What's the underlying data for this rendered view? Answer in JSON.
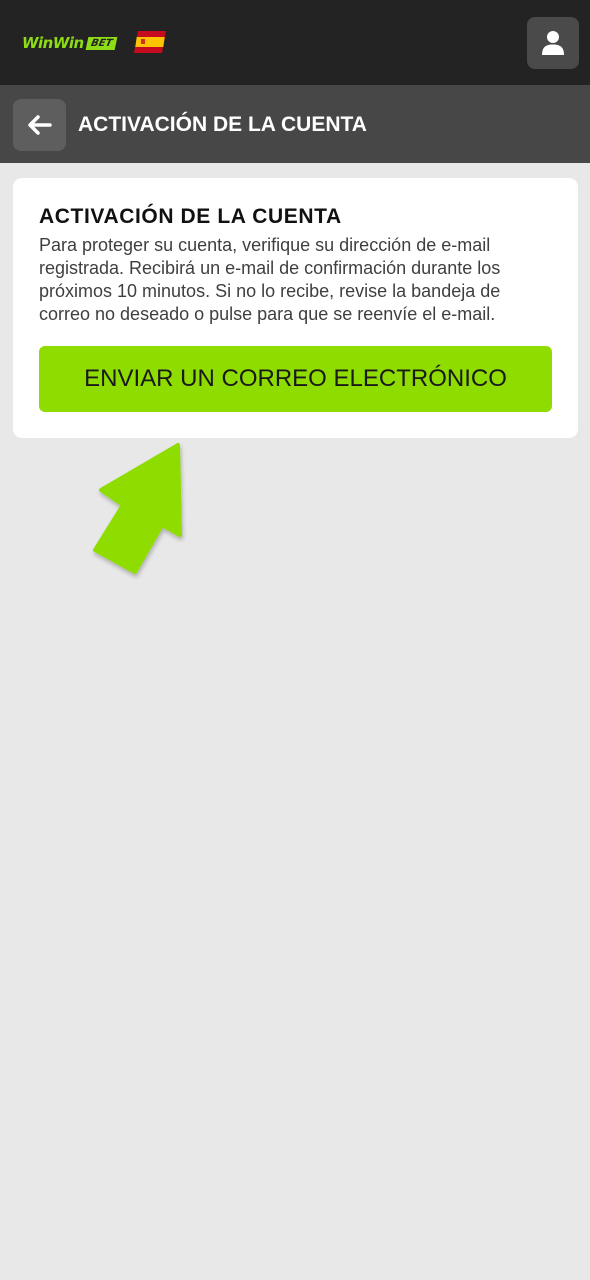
{
  "header": {
    "logo": {
      "part1": "Win",
      "part2": "Win",
      "badge": "BET"
    },
    "language_flag": "spain-flag-icon",
    "user_icon": "user-icon"
  },
  "subheader": {
    "back_icon": "arrow-left-icon",
    "title": "ACTIVACIÓN DE LA CUENTA"
  },
  "card": {
    "title": "ACTIVACIÓN DE LA CUENTA",
    "description": "Para proteger su cuenta, verifique su dirección de e-mail registrada. Recibirá un e-mail de confirmación durante los próximos 10 minutos. Si no lo recibe, revise la bandeja de correo no deseado o pulse para que se reenvíe el e-mail.",
    "button_label": "ENVIAR UN CORREO ELECTRÓNICO"
  },
  "annotation_icon": "pointer-arrow-icon",
  "colors": {
    "accent": "#8edc00",
    "topbar": "#232323",
    "subheader": "#474747",
    "background": "#e8e8e8"
  }
}
